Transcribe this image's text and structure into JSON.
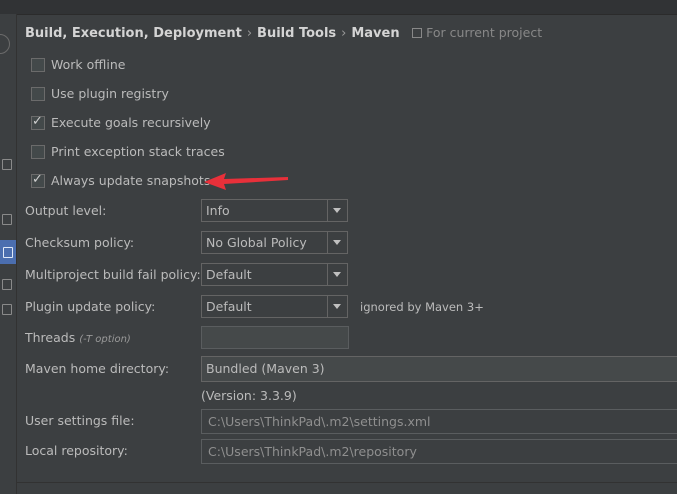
{
  "breadcrumb": {
    "items": [
      "Build, Execution, Deployment",
      "Build Tools",
      "Maven"
    ],
    "scope": "For current project"
  },
  "checkboxes": [
    {
      "label": "Work offline",
      "checked": false
    },
    {
      "label": "Use plugin registry",
      "checked": false
    },
    {
      "label": "Execute goals recursively",
      "checked": true
    },
    {
      "label": "Print exception stack traces",
      "checked": false
    },
    {
      "label": "Always update snapshots",
      "checked": true
    }
  ],
  "fields": {
    "output_level": {
      "label": "Output level:",
      "value": "Info"
    },
    "checksum_policy": {
      "label": "Checksum policy:",
      "value": "No Global Policy"
    },
    "multiproject_fail_policy": {
      "label": "Multiproject build fail policy:",
      "value": "Default"
    },
    "plugin_update_policy": {
      "label": "Plugin update policy:",
      "value": "Default",
      "note": "ignored by Maven 3+"
    },
    "threads": {
      "label": "Threads",
      "hint": "(-T option)",
      "value": ""
    },
    "maven_home": {
      "label": "Maven home directory:",
      "value": "Bundled (Maven 3)",
      "version": "(Version: 3.3.9)"
    },
    "user_settings": {
      "label": "User settings file:",
      "value": "C:\\Users\\ThinkPad\\.m2\\settings.xml"
    },
    "local_repository": {
      "label": "Local repository:",
      "value": "C:\\Users\\ThinkPad\\.m2\\repository"
    }
  },
  "icons": {
    "sidebar": [
      "settings-node-icon",
      "maven-page-icon"
    ],
    "scope": "project-scope-icon",
    "dropdown": "chevron-down-icon",
    "annotation": "red-arrow"
  },
  "colors": {
    "background": "#3c3f41",
    "text": "#bbbbbb",
    "selection": "#4b6eaf",
    "annotation_arrow": "#e8303a"
  }
}
